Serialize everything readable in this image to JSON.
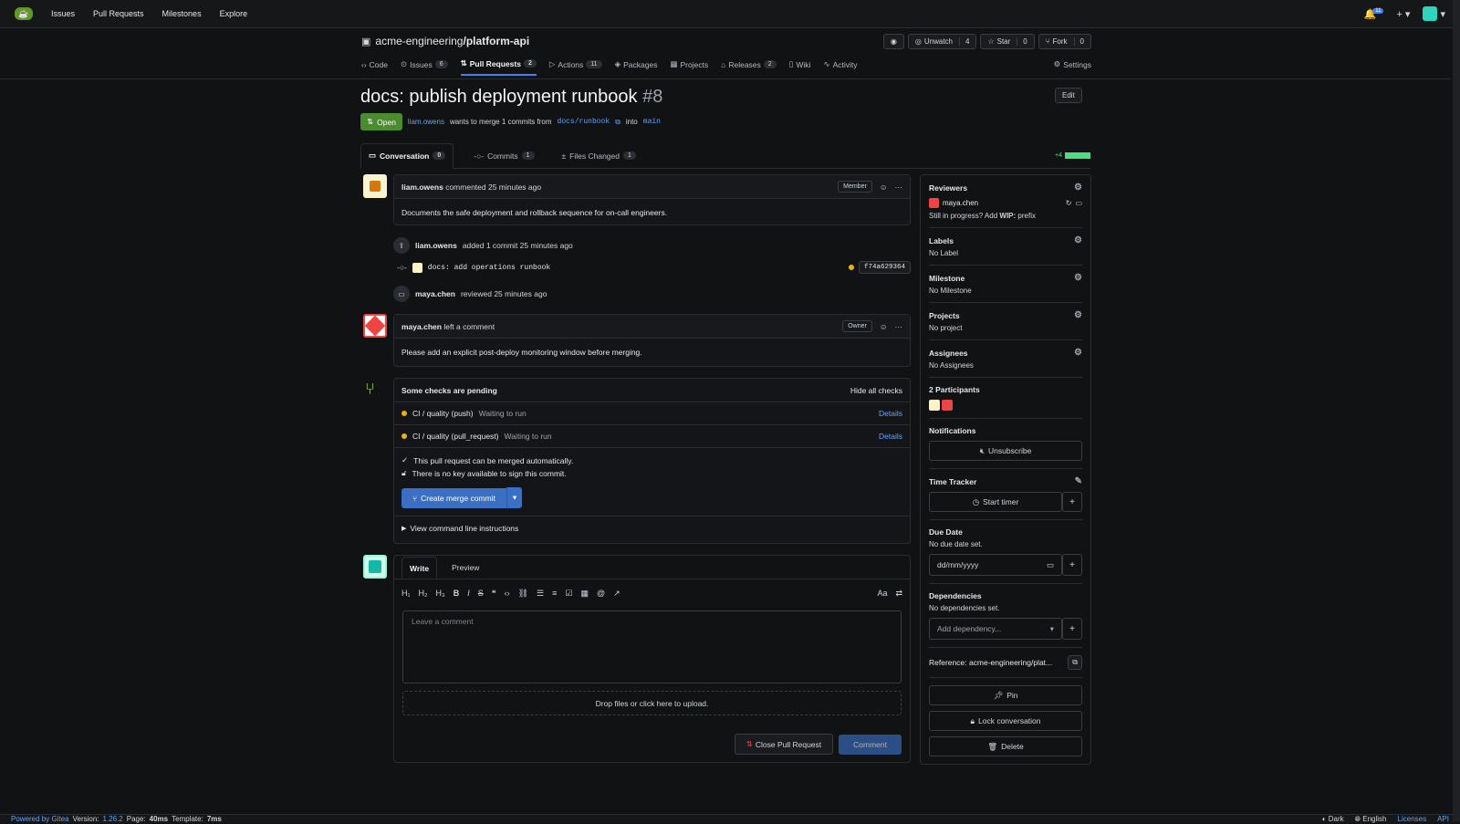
{
  "nav": {
    "links": [
      "Issues",
      "Pull Requests",
      "Milestones",
      "Explore"
    ],
    "notif_count": "11"
  },
  "repo": {
    "owner": "acme-engineering",
    "sep": "/",
    "name": "platform-api",
    "unwatch": "Unwatch",
    "unwatch_count": "4",
    "star": "Star",
    "star_count": "0",
    "fork": "Fork",
    "fork_count": "0"
  },
  "tabs": [
    {
      "label": "Code",
      "count": ""
    },
    {
      "label": "Issues",
      "count": "6"
    },
    {
      "label": "Pull Requests",
      "count": "2"
    },
    {
      "label": "Actions",
      "count": "11"
    },
    {
      "label": "Packages",
      "count": ""
    },
    {
      "label": "Projects",
      "count": ""
    },
    {
      "label": "Releases",
      "count": "2"
    },
    {
      "label": "Wiki",
      "count": ""
    },
    {
      "label": "Activity",
      "count": ""
    }
  ],
  "settings_label": "Settings",
  "pr": {
    "title": "docs: publish deployment runbook",
    "number": "#8",
    "edit": "Edit",
    "status": "Open",
    "author": "liam.owens",
    "wants": "wants to merge 1 commits from",
    "head": "docs/runbook",
    "into": "into",
    "base": "main"
  },
  "prtabs": [
    {
      "label": "Conversation",
      "count": "0"
    },
    {
      "label": "Commits",
      "count": "1"
    },
    {
      "label": "Files Changed",
      "count": "1"
    }
  ],
  "diffstat": "+4",
  "comment1": {
    "author": "liam.owens",
    "action": "commented 25 minutes ago",
    "role": "Member",
    "body": "Documents the safe deployment and rollback sequence for on-call engineers."
  },
  "event1": {
    "author": "liam.owens",
    "action": "added 1 commit 25 minutes ago"
  },
  "commit": {
    "message": "docs: add operations runbook",
    "sha": "f74a629364"
  },
  "event2": {
    "author": "maya.chen",
    "action": "reviewed 25 minutes ago"
  },
  "comment2": {
    "author": "maya.chen",
    "action": "left a comment",
    "role": "Owner",
    "body": "Please add an explicit post-deploy monitoring window before merging."
  },
  "checks": {
    "title": "Some checks are pending",
    "hide": "Hide all checks",
    "items": [
      {
        "name": "CI / quality (push)",
        "status": "Waiting to run",
        "details": "Details"
      },
      {
        "name": "CI / quality (pull_request)",
        "status": "Waiting to run",
        "details": "Details"
      }
    ],
    "merge_ok": "This pull request can be merged automatically.",
    "no_key": "There is no key available to sign this commit.",
    "merge_btn": "Create merge commit",
    "cli": "View command line instructions"
  },
  "editor": {
    "write": "Write",
    "preview": "Preview",
    "placeholder": "Leave a comment",
    "drop": "Drop files or click here to upload.",
    "close": "Close Pull Request",
    "comment": "Comment"
  },
  "sidebar": {
    "reviewers": "Reviewers",
    "reviewer": "maya.chen",
    "wip": "Still in progress? Add",
    "wip_b": "WIP:",
    "wip_c": "prefix",
    "labels": "Labels",
    "no_label": "No Label",
    "milestone": "Milestone",
    "no_milestone": "No Milestone",
    "projects": "Projects",
    "no_project": "No project",
    "assignees": "Assignees",
    "no_assignees": "No Assignees",
    "participants": "2 Participants",
    "notifications": "Notifications",
    "unsubscribe": "Unsubscribe",
    "time": "Time Tracker",
    "start": "Start timer",
    "due": "Due Date",
    "no_due": "No due date set.",
    "date_ph": "dd/mm/yyyy",
    "deps": "Dependencies",
    "no_deps": "No dependencies set.",
    "add_dep": "Add dependency...",
    "reference": "Reference: acme-engineering/plat...",
    "pin": "Pin",
    "lock": "Lock conversation",
    "delete": "Delete"
  },
  "footer": {
    "powered": "Powered by Gitea",
    "version": "Version:",
    "version_num": "1.26.2",
    "page": "Page:",
    "page_time": "40ms",
    "template": "Template:",
    "template_time": "7ms",
    "dark": "Dark",
    "lang": "English",
    "licenses": "Licenses",
    "api": "API"
  }
}
